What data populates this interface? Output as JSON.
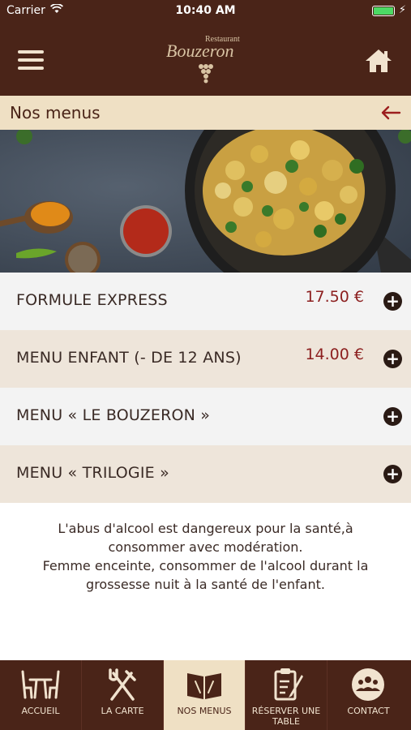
{
  "status_bar": {
    "carrier": "Carrier",
    "time": "10:40 AM"
  },
  "header": {
    "logo_small": "Restaurant",
    "logo_name": "Bouzeron",
    "menu_icon": "hamburger-icon",
    "home_icon": "home-icon"
  },
  "page": {
    "title": "Nos menus",
    "back_icon": "arrow-left-icon"
  },
  "menus": [
    {
      "name": "FORMULE EXPRESS",
      "price": "17.50 €"
    },
    {
      "name": "MENU ENFANT (- DE 12 ANS)",
      "price": "14.00 €"
    },
    {
      "name": "MENU « LE BOUZERON »",
      "price": ""
    },
    {
      "name": "MENU « TRILOGIE »",
      "price": ""
    }
  ],
  "disclaimer": {
    "line1": "L'abus d'alcool est dangereux pour la santé,à",
    "line2": "consommer avec modération.",
    "line3": "Femme enceinte, consommer de l'alcool durant la",
    "line4": "grossesse nuit à la santé de l'enfant."
  },
  "tabs": [
    {
      "label": "ACCUEIL",
      "icon": "table-chairs-icon"
    },
    {
      "label": "LA CARTE",
      "icon": "fork-knife-icon"
    },
    {
      "label": "NOS MENUS",
      "icon": "menu-book-icon"
    },
    {
      "label": "RÉSERVER UNE TABLE",
      "icon": "clipboard-pen-icon"
    },
    {
      "label": "CONTACT",
      "icon": "people-icon"
    }
  ],
  "colors": {
    "brand_brown": "#4a2418",
    "cream": "#efe0c4",
    "price_red": "#8c1f1f",
    "row_light": "#f3f3f3",
    "row_beige": "#eee5da"
  }
}
